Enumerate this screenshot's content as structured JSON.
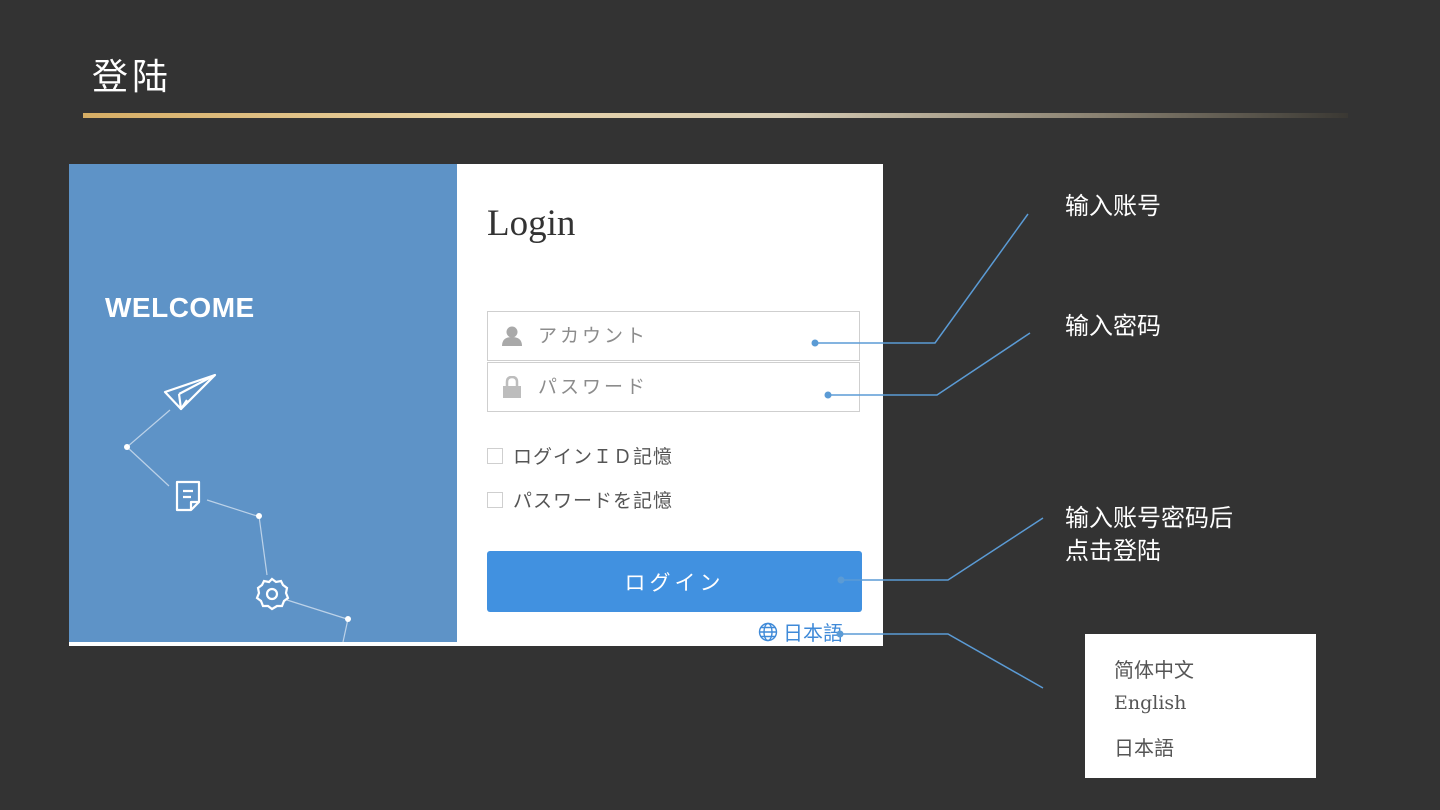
{
  "slide": {
    "title": "登陆"
  },
  "left_panel": {
    "welcome": "WELCOME"
  },
  "login": {
    "title": "Login",
    "account_placeholder": "アカウント",
    "password_placeholder": "パスワード",
    "remember_id_label": "ログインＩＤ記憶",
    "remember_password_label": "パスワードを記憶",
    "submit_label": "ログイン",
    "language_label": "日本語"
  },
  "annotations": {
    "account": "输入账号",
    "password": "输入密码",
    "submit_line1": "输入账号密码后",
    "submit_line2": "点击登陆"
  },
  "language_menu": {
    "options": [
      "简体中文",
      "English",
      "日本語"
    ]
  },
  "colors": {
    "background": "#333333",
    "panel_blue": "#5e93c7",
    "button_blue": "#4191e0",
    "connector": "#5b9bd5",
    "gold_rule": "#d6ad64"
  },
  "icons": [
    "user-icon",
    "lock-icon",
    "paper-plane-icon",
    "document-icon",
    "gear-icon",
    "globe-icon"
  ]
}
